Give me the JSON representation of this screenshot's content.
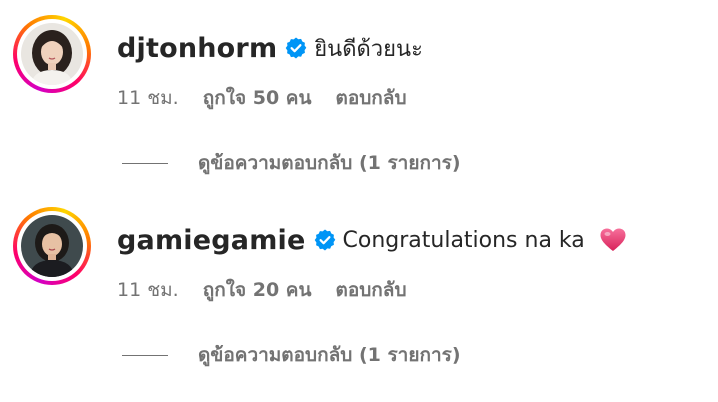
{
  "comments": [
    {
      "username": "djtonhorm",
      "verified": true,
      "text": "ยินดีด้วยนะ",
      "time": "11 ชม.",
      "likes": "ถูกใจ 50 คน",
      "reply_label": "ตอบกลับ",
      "view_replies": "ดูข้อความตอบกลับ (1 รายการ)",
      "emoji": null
    },
    {
      "username": "gamiegamie",
      "verified": true,
      "text": "Congratulations na ka",
      "time": "11 ชม.",
      "likes": "ถูกใจ 20 คน",
      "reply_label": "ตอบกลับ",
      "view_replies": "ดูข้อความตอบกลับ (1 รายการ)",
      "emoji": "heart-icon"
    }
  ],
  "colors": {
    "primary_text": "#262626",
    "secondary_text": "#737373",
    "verified_blue": "#0095f6",
    "heart_pink": "#e8336f"
  }
}
